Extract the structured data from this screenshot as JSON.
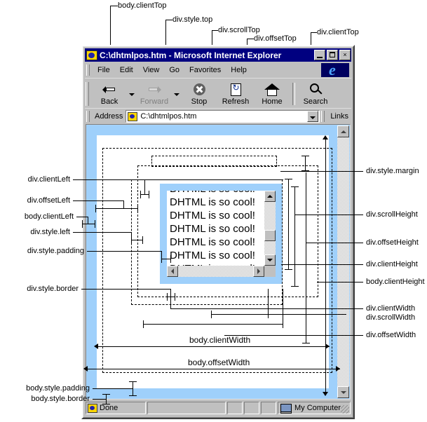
{
  "window": {
    "title": "C:\\dhtmlpos.htm - Microsoft Internet Explorer",
    "icon": "ie-document-icon",
    "buttons": {
      "minimize": "_",
      "maximize": "□",
      "close": "×"
    }
  },
  "menu": {
    "items": [
      "File",
      "Edit",
      "View",
      "Go",
      "Favorites",
      "Help"
    ]
  },
  "toolbar": {
    "items": [
      {
        "label": "Back",
        "icon": "arrow-left-icon",
        "disabled": false,
        "dropdown": true
      },
      {
        "label": "Forward",
        "icon": "arrow-right-icon",
        "disabled": true,
        "dropdown": true
      },
      {
        "label": "Stop",
        "icon": "stop-icon",
        "disabled": false,
        "dropdown": false
      },
      {
        "label": "Refresh",
        "icon": "refresh-icon",
        "disabled": false,
        "dropdown": false
      },
      {
        "label": "Home",
        "icon": "home-icon",
        "disabled": false,
        "dropdown": false
      },
      {
        "label": "Search",
        "icon": "search-icon",
        "disabled": false,
        "dropdown": false
      }
    ]
  },
  "address": {
    "label": "Address",
    "value": "C:\\dhtmlpos.htm",
    "placeholder": "C:\\dhtmlpos.htm",
    "links_label": "Links",
    "dropdown_icon": "chevron-down-icon"
  },
  "page": {
    "div_text": "DHTML is so cool! DHTML is so cool! DHTML is so cool! DHTML is so cool! DHTML is so cool! DHTML is so cool! DHTML is so cool!"
  },
  "status": {
    "message": "Done",
    "zone": "My Computer",
    "done_icon": "ie-document-icon",
    "computer_icon": "computer-icon"
  },
  "labels": {
    "top": [
      "body.clientTop",
      "div.style.top",
      "div.scrollTop",
      "div.offsetTop",
      "div.clientTop"
    ],
    "left": [
      "div.clientLeft",
      "div.offsetLeft",
      "body.clientLeft",
      "div.style.left",
      "div.style.padding",
      "div.style.border",
      "body.style.padding",
      "body.style.border"
    ],
    "right": [
      "div.style.margin",
      "div.scrollHeight",
      "div.offsetHeight",
      "div.clientHeight",
      "body.clientHeight",
      "div.clientWidth",
      "div.scrollWidth",
      "div.offsetWidth"
    ],
    "center": [
      "body.clientWidth",
      "body.offsetWidth"
    ]
  },
  "colors": {
    "titlebar": "#000080",
    "chrome": "#c0c0c0",
    "body_blue": "#9fd0fb",
    "page_white": "#ffffff",
    "line": "#000000"
  }
}
